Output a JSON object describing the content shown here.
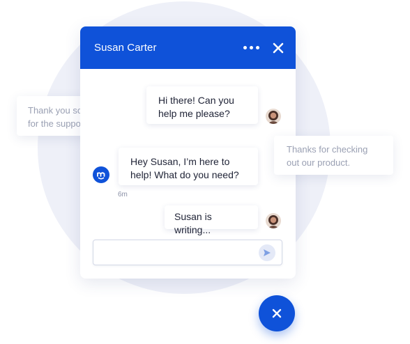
{
  "header": {
    "title": "Susan Carter",
    "more_icon": "more-horizontal-icon",
    "close_icon": "close-icon"
  },
  "messages": [
    {
      "sender": "user",
      "text": "Hi there! Can you help me please?"
    },
    {
      "sender": "agent",
      "text": "Hey Susan, I’m here to help! What do you need?"
    },
    {
      "sender": "user",
      "text": "Susan is writing..."
    }
  ],
  "timestamp": "6m",
  "composer": {
    "value": "",
    "send_icon": "send-icon"
  },
  "floating_cards": {
    "left": "Thank you so much for the support!",
    "right": "Thanks for checking out our product."
  },
  "launcher": {
    "icon": "close-icon"
  },
  "colors": {
    "primary": "#0f52d9",
    "background_circle": "#eef0f8",
    "card_text": "#9aa0b3",
    "message_text": "#1e2235"
  }
}
